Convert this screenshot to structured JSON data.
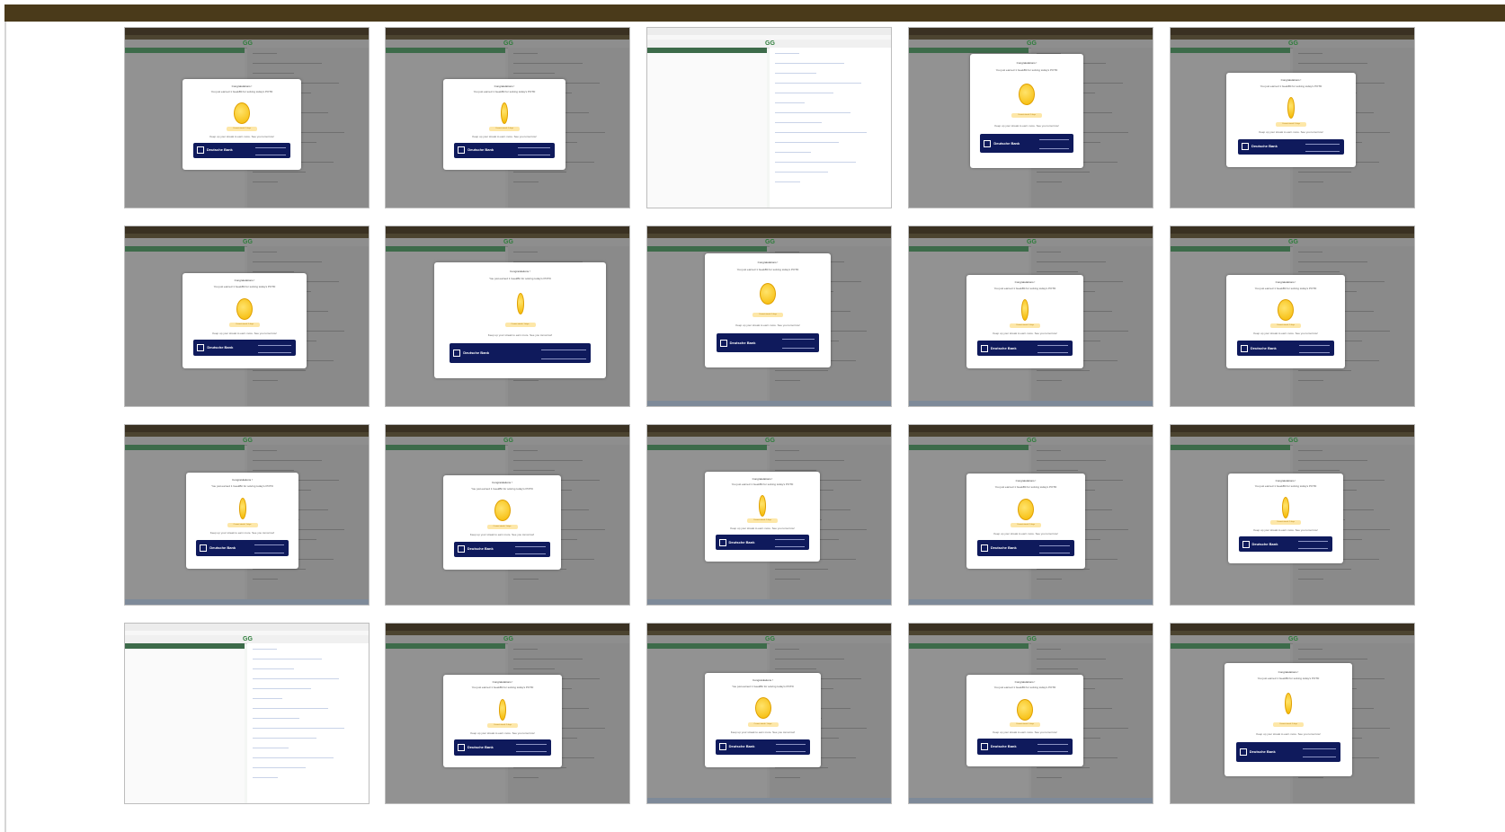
{
  "header": {
    "bar_color": "#4a3a1a"
  },
  "colors": {
    "coin": "#f5b800",
    "banner": "#0f1a5c",
    "site_logo": "#2d7d3a",
    "overlay": "#8f8f8f"
  },
  "thumbnails": [
    {
      "id": 1,
      "style": "modal",
      "coin": "round"
    },
    {
      "id": 2,
      "style": "modal",
      "coin": "thin"
    },
    {
      "id": 3,
      "style": "editor"
    },
    {
      "id": 4,
      "style": "modal",
      "coin": "round"
    },
    {
      "id": 5,
      "style": "modal",
      "coin": "thin"
    },
    {
      "id": 6,
      "style": "modal",
      "coin": "round"
    },
    {
      "id": 7,
      "style": "modal",
      "coin": "thin"
    },
    {
      "id": 8,
      "style": "modal",
      "coin": "round"
    },
    {
      "id": 9,
      "style": "modal",
      "coin": "thin"
    },
    {
      "id": 10,
      "style": "modal",
      "coin": "round"
    },
    {
      "id": 11,
      "style": "modal",
      "coin": "thin"
    },
    {
      "id": 12,
      "style": "modal",
      "coin": "round"
    },
    {
      "id": 13,
      "style": "modal",
      "coin": "thin"
    },
    {
      "id": 14,
      "style": "modal",
      "coin": "round"
    },
    {
      "id": 15,
      "style": "modal",
      "coin": "thin"
    },
    {
      "id": 16,
      "style": "editor"
    },
    {
      "id": 17,
      "style": "modal",
      "coin": "thin"
    },
    {
      "id": 18,
      "style": "modal",
      "coin": "round"
    },
    {
      "id": 19,
      "style": "modal",
      "coin": "round"
    },
    {
      "id": 20,
      "style": "modal",
      "coin": "thin"
    }
  ],
  "modal": {
    "title": "Congratulations !",
    "subtitle": "You just earned 1 GeekBit for solving today's POTD",
    "streak": "Current streak: 1 days",
    "footer": "Keep up your streak to earn more. See you tomorrow!",
    "sponsor": "Deutsche Bank"
  },
  "site_logo": "GG"
}
